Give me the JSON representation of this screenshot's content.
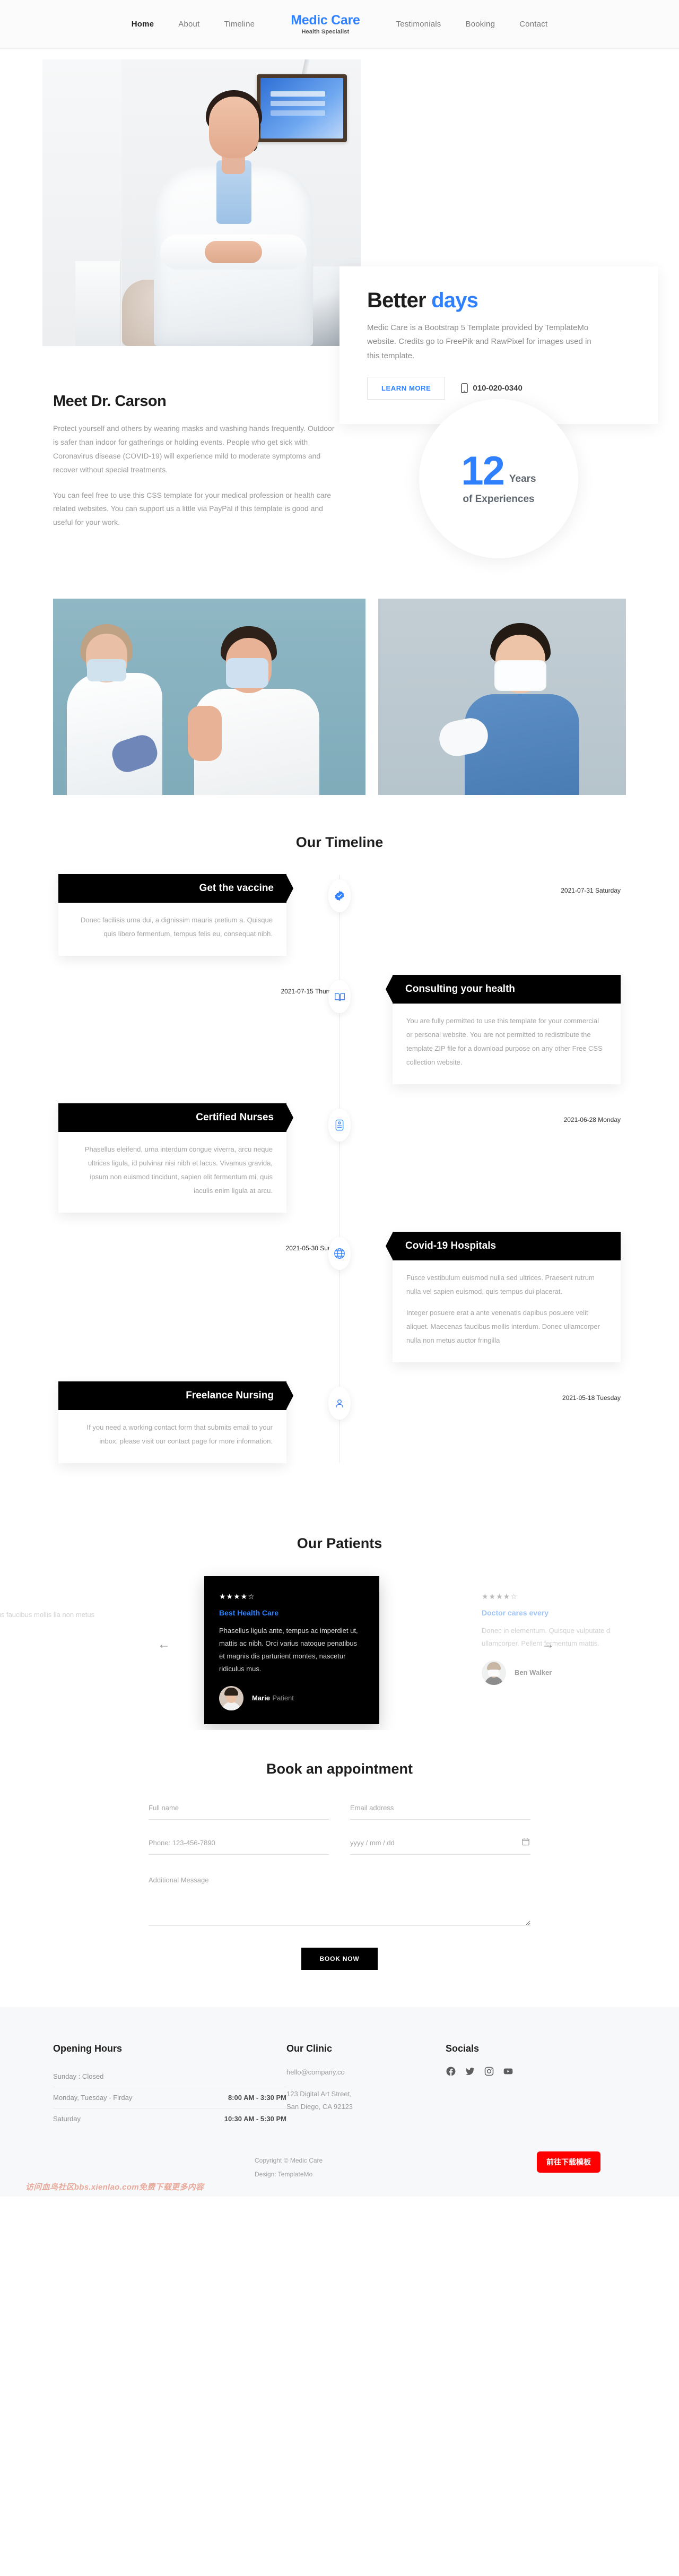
{
  "nav": {
    "brand": {
      "title": "Medic Care",
      "subtitle": "Health Specialist"
    },
    "links_left": [
      {
        "label": "Home",
        "active": true
      },
      {
        "label": "About",
        "active": false
      },
      {
        "label": "Timeline",
        "active": false
      }
    ],
    "links_right": [
      {
        "label": "Testimonials"
      },
      {
        "label": "Booking"
      },
      {
        "label": "Contact"
      }
    ]
  },
  "hero": {
    "title_plain": "Better",
    "title_accent": "days",
    "description": "Medic Care is a Bootstrap 5 Template provided by TemplateMo website. Credits go to FreePik and RawPixel for images used in this template.",
    "learn_more": "LEARN MORE",
    "phone": "010-020-0340",
    "phone_icon": "mobile-phone-icon",
    "image_alt": "doctor-portrait"
  },
  "about": {
    "heading": "Meet Dr. Carson",
    "paragraph1": "Protect yourself and others by wearing masks and washing hands frequently. Outdoor is safer than indoor for gatherings or holding events. People who get sick with Coronavirus disease (COVID-19) will experience mild to moderate symptoms and recover without special treatments.",
    "paragraph2": "You can feel free to use this CSS template for your medical profession or health care related websites. You can support us a little via PayPal if this template is good and useful for your work.",
    "experience": {
      "number": "12",
      "years_label": "Years",
      "of_label": "of Experiences"
    }
  },
  "gallery": {
    "image1_alt": "nurse-vaccinating-teen",
    "image2_alt": "nurse-presenting"
  },
  "timeline": {
    "title": "Our Timeline",
    "items": [
      {
        "side": "left",
        "title": "Get the vaccine",
        "date": "2021-07-31 Saturday",
        "icon": "check-badge-icon",
        "paragraphs": [
          "Donec facilisis urna dui, a dignissim mauris pretium a. Quisque quis libero fermentum, tempus felis eu, consequat nibh."
        ]
      },
      {
        "side": "right",
        "title": "Consulting your health",
        "date": "2021-07-15 Thursday",
        "icon": "book-icon",
        "paragraphs": [
          "You are fully permitted to use this template for your commercial or personal website. You are not permitted to redistribute the template ZIP file for a download purpose on any other Free CSS collection website."
        ]
      },
      {
        "side": "left",
        "title": "Certified Nurses",
        "date": "2021-06-28 Monday",
        "icon": "certificate-icon",
        "paragraphs": [
          "Phasellus eleifend, urna interdum congue viverra, arcu neque ultrices ligula, id pulvinar nisi nibh et lacus. Vivamus gravida, ipsum non euismod tincidunt, sapien elit fermentum mi, quis iaculis enim ligula at arcu."
        ]
      },
      {
        "side": "right",
        "title": "Covid-19 Hospitals",
        "date": "2021-05-30 Sunday",
        "icon": "globe-icon",
        "paragraphs": [
          "Fusce vestibulum euismod nulla sed ultrices. Praesent rutrum nulla vel sapien euismod, quis tempus dui placerat.",
          "Integer posuere erat a ante venenatis dapibus posuere velit aliquet. Maecenas faucibus mollis interdum. Donec ullamcorper nulla non metus auctor fringilla"
        ]
      },
      {
        "side": "left",
        "title": "Freelance Nursing",
        "date": "2021-05-18 Tuesday",
        "icon": "person-icon",
        "paragraphs": [
          "If you need a working contact form that submits email to your inbox, please visit our contact page for more information."
        ]
      }
    ]
  },
  "patients": {
    "title": "Our Patients",
    "prev_icon": "arrow-left-icon",
    "next_icon": "arrow-right-icon",
    "cards": [
      {
        "position": "left",
        "stars": "★★★★☆",
        "heading": "",
        "quote": "venatis dapibus faucibus mollis lla non metus",
        "name": "",
        "role": ""
      },
      {
        "position": "active",
        "stars": "★★★★☆",
        "heading": "Best Health Care",
        "quote": "Phasellus ligula ante, tempus ac imperdiet ut, mattis ac nibh. Orci varius natoque penatibus et magnis dis parturient montes, nascetur ridiculus mus.",
        "name": "Marie",
        "role": "Patient"
      },
      {
        "position": "right",
        "stars": "★★★★☆",
        "heading": "Doctor cares every",
        "quote": "Donec in elementum. Quisque vulputate d ullamcorper. Pellent fermentum mattis.",
        "name": "Ben Walker",
        "role": ""
      }
    ]
  },
  "booking": {
    "title": "Book an appointment",
    "fullname_placeholder": "Full name",
    "email_placeholder": "Email address",
    "phone_placeholder": "Phone: 123-456-7890",
    "date_placeholder": "yyyy / mm / dd",
    "date_icon": "calendar-icon",
    "message_placeholder": "Additional Message",
    "submit_label": "BOOK NOW"
  },
  "footer": {
    "opening_hours": {
      "heading": "Opening Hours",
      "rows": [
        {
          "day": "Sunday : Closed",
          "time": ""
        },
        {
          "day": "Monday, Tuesday - Firday",
          "time": "8:00 AM - 3:30 PM"
        },
        {
          "day": "Saturday",
          "time": "10:30 AM - 5:30 PM"
        }
      ]
    },
    "clinic": {
      "heading": "Our Clinic",
      "email": "hello@company.co",
      "address": "123 Digital Art Street, San Diego, CA 92123"
    },
    "socials": {
      "heading": "Socials",
      "icons": [
        "facebook-icon",
        "twitter-icon",
        "instagram-icon",
        "youtube-icon"
      ]
    },
    "copyright": "Copyright © Medic Care",
    "design": "Design: TemplateMo",
    "download_button": "前往下载模板",
    "watermark": "访问血鸟社区bbs.xienlao.com免费下载更多内容"
  },
  "colors": {
    "accent": "#2f80ff",
    "dark": "#000000",
    "muted": "#9a9a9a",
    "download_red": "#ff0000"
  }
}
